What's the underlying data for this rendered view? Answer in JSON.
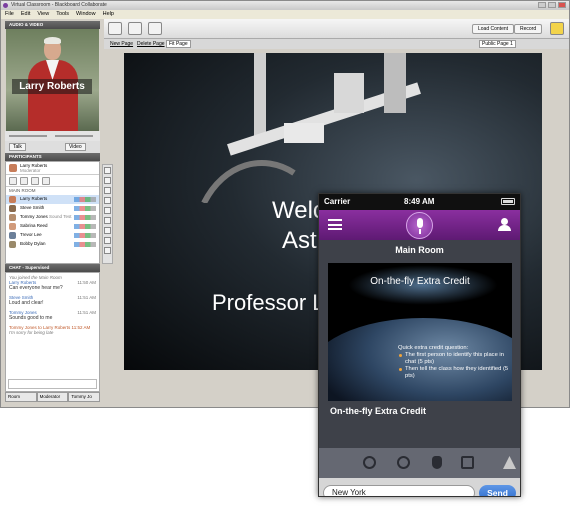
{
  "desktop": {
    "window_title": "Virtual Classroom - Blackboard Collaborate",
    "menu": [
      "File",
      "Edit",
      "View",
      "Tools",
      "Window",
      "Help"
    ],
    "toolbar": {
      "load_content": "Load Content",
      "record": "Record",
      "page_select": "Public Page 1"
    },
    "subbar": {
      "new_page": "New Page",
      "delete_page": "Delete Page",
      "fit": "Fit Page"
    },
    "audio_video": {
      "panel_title": "AUDIO & VIDEO",
      "presenter_name": "Larry Roberts",
      "talk_label": "Talk",
      "video_label": "Video"
    },
    "participants": {
      "panel_title": "PARTICIPANTS",
      "me_name": "Larry Roberts",
      "me_status": "Moderator",
      "group_label": "MAIN ROOM",
      "list": [
        "Larry Roberts",
        "Steve Smith",
        "Tommy Jones",
        "Sabrina Reed",
        "Trevor Lee",
        "Bobby Dylan"
      ],
      "sublabel": "Sound Test"
    },
    "chat": {
      "panel_title": "CHAT - Supervised",
      "messages": [
        {
          "who": "Larry Roberts",
          "time": "11:50 AM",
          "text": "Can everyone hear me?"
        },
        {
          "who": "Steve Smith",
          "time": "11:51 AM",
          "text": "Loud and clear!"
        },
        {
          "who": "Tommy Jones",
          "time": "11:51 AM",
          "text": "Sounds good to me"
        }
      ],
      "system_intro": "You joined the Main Room",
      "private_msg": {
        "who": "Tommy Jones to Larry Roberts",
        "time": "11:52 AM",
        "text": "I'm sorry for being late"
      }
    },
    "bottom_tabs": [
      "Room",
      "Moderator",
      "Tommy Jo"
    ],
    "whiteboard": {
      "line1": "Welc",
      "line2": "Astron",
      "line3": "Professor L"
    }
  },
  "phone": {
    "carrier": "Carrier",
    "time": "8:49 AM",
    "room_title": "Main Room",
    "slide": {
      "title": "On-the-fly Extra Credit",
      "intro": "Quick extra credit question:",
      "bullets": [
        "The first person to identify this place in chat (5 pts)",
        "Then tell the class how they identified (5 pts)"
      ]
    },
    "card_title": "On-the-fly Extra Credit",
    "input_value": "New York",
    "send_label": "Send",
    "colors": {
      "nav_purple": "#7a2a92",
      "send_blue": "#2f6ccc"
    }
  }
}
